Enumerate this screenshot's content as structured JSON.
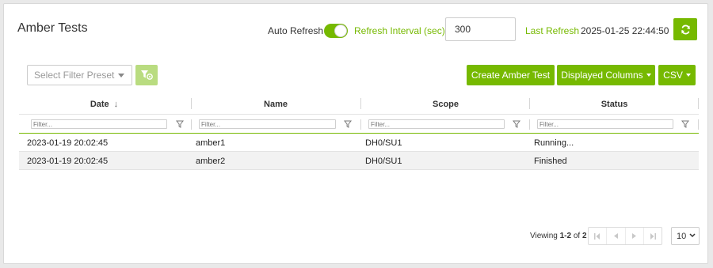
{
  "header": {
    "title": "Amber Tests",
    "auto_refresh_label": "Auto Refresh",
    "auto_refresh_on": true,
    "interval_label": "Refresh Interval (sec)",
    "interval_value": "300",
    "last_refresh_label": "Last Refresh",
    "last_refresh_value": "2025-01-25 22:44:50",
    "refresh_icon": "refresh-icon"
  },
  "toolbar": {
    "filter_preset_placeholder": "Select Filter Preset",
    "filter_preset_icon": "filter-settings-icon",
    "create_label": "Create Amber Test",
    "columns_label": "Displayed Columns",
    "csv_label": "CSV"
  },
  "table": {
    "columns": [
      {
        "label": "Date",
        "sort": "↓"
      },
      {
        "label": "Name"
      },
      {
        "label": "Scope"
      },
      {
        "label": "Status"
      }
    ],
    "filter_placeholder": "Filter...",
    "rows": [
      {
        "date": "2023-01-19 20:02:45",
        "name": "amber1",
        "scope": "DH0/SU1",
        "status": "Running..."
      },
      {
        "date": "2023-01-19 20:02:45",
        "name": "amber2",
        "scope": "DH0/SU1",
        "status": "Finished"
      }
    ]
  },
  "pagination": {
    "viewing_prefix": "Viewing ",
    "range": "1-2",
    "of_text": " of ",
    "total": "2",
    "page_size": "10"
  },
  "colors": {
    "accent": "#76b900",
    "accent_disabled": "#b9dc80",
    "alt_row": "#f2f2f2"
  }
}
